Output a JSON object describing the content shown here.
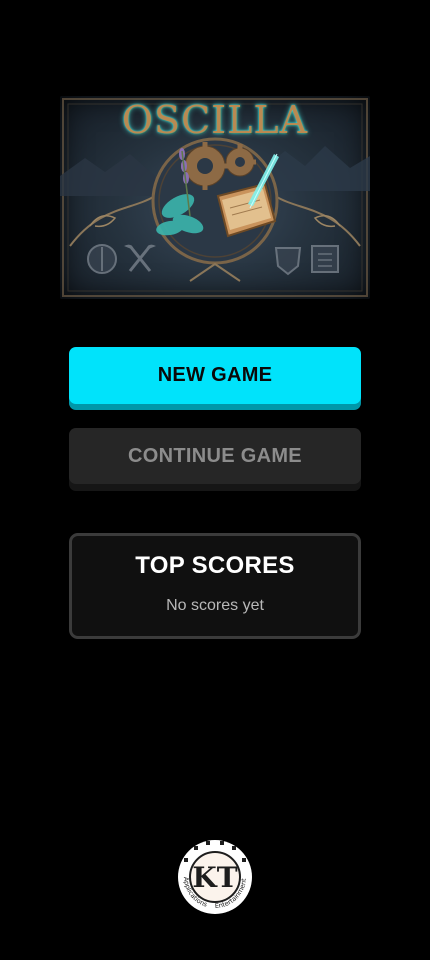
{
  "banner": {
    "title": "OSCILLA"
  },
  "buttons": {
    "new_game": "NEW GAME",
    "continue_game": "CONTINUE GAME"
  },
  "scores": {
    "title": "TOP SCORES",
    "empty_text": "No scores yet"
  },
  "logo": {
    "mark": "KT",
    "left_text": "Applications",
    "right_text": "Entertainment"
  },
  "colors": {
    "background": "#000000",
    "accent": "#00e3fb",
    "accent_shadow": "#0097a9",
    "disabled_button": "#262626",
    "disabled_text": "#8c8c8c"
  }
}
